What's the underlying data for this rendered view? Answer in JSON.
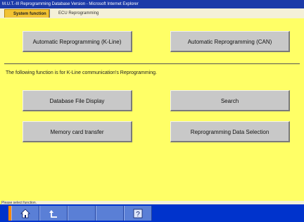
{
  "window": {
    "title": "M.U.T.-III Reprogramming Database Version - Microsoft Internet Explorer"
  },
  "tabs": [
    {
      "label": "System function"
    },
    {
      "label": "ECU Reprogramming"
    }
  ],
  "buttons": {
    "auto_kline": "Automatic Reprogramming (K-Line)",
    "auto_can": "Automatic Reprogramming (CAN)",
    "database_file_display": "Database File Display",
    "search": "Search",
    "memory_card_transfer": "Memory card transfer",
    "reprogramming_data_selection": "Reprogramming Data Selection"
  },
  "note": "The following function is for K-Line communication's Reprogramming.",
  "status": {
    "text": "Please select function."
  },
  "toolbar": {
    "icons": [
      "home-icon",
      "back-icon",
      "help-icon"
    ],
    "help_glyph": "?"
  },
  "colors": {
    "background": "#ffff66",
    "title_bar": "#1c3aa8",
    "toolbar": "#0033cc",
    "toolbar_button": "#5a7fd6",
    "button_face": "#c8c8c8",
    "active_tab": "#f1c232",
    "accent": "#ff8800"
  }
}
